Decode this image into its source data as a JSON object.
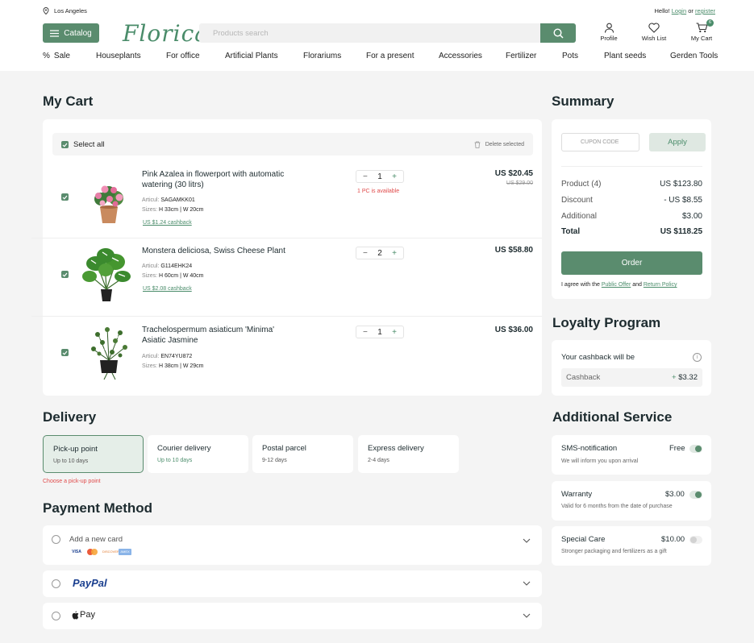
{
  "header": {
    "city": "Los Angeles",
    "hello_prefix": "Hello!",
    "login": "Login",
    "or": "or",
    "register": "register",
    "catalog_label": "Catalog",
    "logo": "Florica",
    "search_placeholder": "Products search",
    "profile": "Profile",
    "wishlist": "Wish List",
    "cart": "My Cart",
    "cart_count": "6"
  },
  "nav": [
    "Sale",
    "Houseplants",
    "For office",
    "Artificial Plants",
    "Florariums",
    "For a present",
    "Accessories",
    "Fertilizer",
    "Pots",
    "Plant seeds",
    "Gerden Tools"
  ],
  "cart": {
    "title": "My Cart",
    "select_all": "Select all",
    "delete_selected": "Delete selected",
    "items": [
      {
        "name": "Pink Azalea in flowerport with automatic watering (30 litrs)",
        "articul_label": "Articul:",
        "articul": "SAGAMKK01",
        "sizes_label": "Sizes:",
        "sizes": "H 33cm | W 20cm",
        "cashback": "US $1.24 cashback",
        "qty": "1",
        "price": "US $20.45",
        "old_price": "US $29.00",
        "note": "1 PC is available"
      },
      {
        "name": "Monstera deliciosa, Swiss Cheese Plant",
        "articul_label": "Articul:",
        "articul": "G114EHK24",
        "sizes_label": "Sizes:",
        "sizes": "H 60cm | W 40cm",
        "cashback": "US $2.08 cashback",
        "qty": "2",
        "price": "US $58.80"
      },
      {
        "name": "Trachelospermum asiaticum 'Minima' Asiatic Jasmine",
        "articul_label": "Articul:",
        "articul": "EN74YU872",
        "sizes_label": "Sizes:",
        "sizes": "H 38cm | W 29cm",
        "qty": "1",
        "price": "US $36.00"
      }
    ]
  },
  "summary": {
    "title": "Summary",
    "coupon_placeholder": "CUPON CODE",
    "apply": "Apply",
    "rows": [
      {
        "label": "Product (4)",
        "value": "US $123.80"
      },
      {
        "label": "Discount",
        "value": "- US $8.55"
      },
      {
        "label": "Additional",
        "value": "$3.00"
      },
      {
        "label": "Total",
        "value": "US $118.25"
      }
    ],
    "order": "Order",
    "agree_prefix": "I agree with the",
    "public_offer": "Public Offer",
    "and": "and",
    "return_policy": "Return Policy"
  },
  "loyalty": {
    "title": "Loyalty Program",
    "label": "Your cashback will be",
    "cashback_label": "Cashback",
    "plus": "+",
    "cashback_value": "$3.32"
  },
  "delivery": {
    "title": "Delivery",
    "options": [
      {
        "title": "Pick-up point",
        "sub": "Up to 10 days",
        "selected": true
      },
      {
        "title": "Courier delivery",
        "sub": "Up to 10 days"
      },
      {
        "title": "Postal parcel",
        "sub": "9-12 days"
      },
      {
        "title": "Express delivery",
        "sub": "2-4 days"
      }
    ],
    "choose_point": "Choose a pick-up point"
  },
  "payment": {
    "title": "Payment Method",
    "add_card": "Add a new card",
    "card_brands": [
      "VISA",
      "mastercard",
      "DISCOVER",
      "AMEX"
    ],
    "paypal": "PayPal",
    "applepay": "Pay"
  },
  "service": {
    "title": "Additional Service",
    "items": [
      {
        "title": "SMS-notification",
        "price": "Free",
        "desc": "We will inform you upon arrival",
        "on": true
      },
      {
        "title": "Warranty",
        "price": "$3.00",
        "desc": "Valid for 6 months from the date of purchase",
        "on": true
      },
      {
        "title": "Special Care",
        "price": "$10.00",
        "desc": "Stronger packaging and fertilizers as a gift",
        "on": false
      }
    ]
  },
  "colors": {
    "accent": "#5a8c6e",
    "accent_text": "#4a8c6a",
    "warning": "#e04b4b",
    "background": "#f4f4f4"
  }
}
